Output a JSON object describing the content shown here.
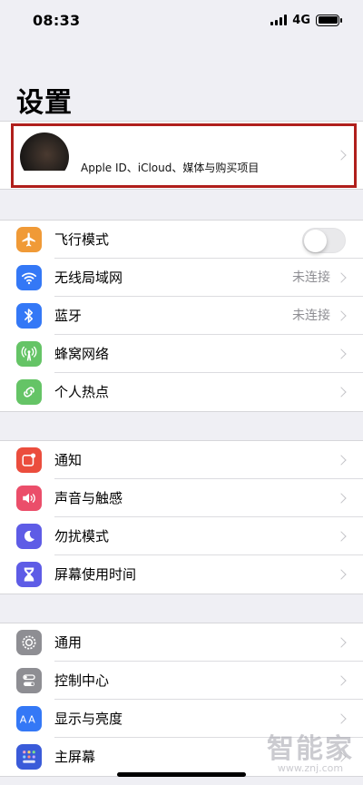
{
  "status_bar": {
    "time": "08:33",
    "network": "4G",
    "signal_bars": 4,
    "battery_level_percent": 100
  },
  "title": "设置",
  "profile": {
    "subtitle": "Apple ID、iCloud、媒体与购买项目",
    "highlight_color": "#b01f1c"
  },
  "groups": [
    {
      "items": [
        {
          "label": "飞行模式",
          "icon": "airplane-icon",
          "icon_color": "#f09a37",
          "toggle_on": false
        },
        {
          "label": "无线局域网",
          "icon": "wifi-icon",
          "icon_color": "#3478f6",
          "value": "未连接"
        },
        {
          "label": "蓝牙",
          "icon": "bluetooth-icon",
          "icon_color": "#3478f6",
          "value": "未连接"
        },
        {
          "label": "蜂窝网络",
          "icon": "cellular-icon",
          "icon_color": "#65c466"
        },
        {
          "label": "个人热点",
          "icon": "hotspot-icon",
          "icon_color": "#65c466"
        }
      ]
    },
    {
      "items": [
        {
          "label": "通知",
          "icon": "notification-icon",
          "icon_color": "#eb4d3d"
        },
        {
          "label": "声音与触感",
          "icon": "sound-icon",
          "icon_color": "#eb4e6a"
        },
        {
          "label": "勿扰模式",
          "icon": "moon-icon",
          "icon_color": "#5e5ce6"
        },
        {
          "label": "屏幕使用时间",
          "icon": "hourglass-icon",
          "icon_color": "#5e5ce6"
        }
      ]
    },
    {
      "items": [
        {
          "label": "通用",
          "icon": "gear-icon",
          "icon_color": "#8e8e93"
        },
        {
          "label": "控制中心",
          "icon": "control-center-icon",
          "icon_color": "#8e8e93"
        },
        {
          "label": "显示与亮度",
          "icon": "display-icon",
          "icon_color": "#3478f6"
        },
        {
          "label": "主屏幕",
          "icon": "home-screen-icon",
          "icon_color": "#3a5bd9"
        }
      ]
    }
  ],
  "watermark": {
    "main": "智能家",
    "sub": "www.znj.com"
  }
}
